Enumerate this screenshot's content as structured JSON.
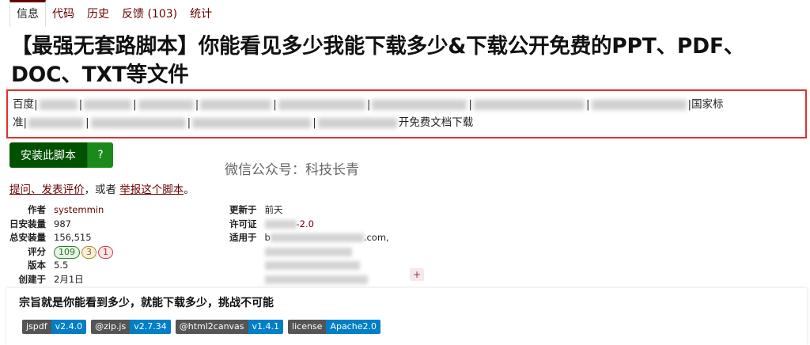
{
  "tabs": [
    {
      "label": "信息",
      "active": true
    },
    {
      "label": "代码",
      "active": false
    },
    {
      "label": "历史",
      "active": false
    },
    {
      "label": "反馈 (103)",
      "active": false
    },
    {
      "label": "统计",
      "active": false
    }
  ],
  "title": "【最强无套路脚本】你能看见多少我能下载多少&下载公开免费的PPT、PDF、DOC、TXT等文件",
  "description": {
    "line1_visible_start": "百度",
    "line1_visible_end": "国家标",
    "line2_start": "准",
    "line2_end": "开免费文档下载",
    "separator": "|"
  },
  "install": {
    "label": "安装此脚本",
    "help_label": "?"
  },
  "watermark": "微信公众号：科技长青",
  "feedback": {
    "link1": "提问、发表评价",
    "middle": "，或者",
    "link2": "举报这个脚本",
    "end": "。"
  },
  "meta_left": {
    "author_label": "作者",
    "author_value": "systemmin",
    "daily_label": "日安装量",
    "daily_value": "987",
    "total_label": "总安装量",
    "total_value": "156,515",
    "rating_label": "评分",
    "rating_good": "109",
    "rating_ok": "3",
    "rating_bad": "1",
    "version_label": "版本",
    "version_value": "5.5",
    "created_label": "创建于",
    "created_value": "2月1日"
  },
  "meta_right": {
    "updated_label": "更新于",
    "updated_value": "前天",
    "license_label": "许可证",
    "license_suffix": "-2.0",
    "applies_label": "适用于",
    "applies_suffix": ".com,",
    "applies_prefix": "b",
    "plus": "+"
  },
  "motto": "宗旨就是你能看到多少，就能下载多少，挑战不可能",
  "shields": [
    {
      "left": "jspdf",
      "right": "v2.4.0"
    },
    {
      "left": "@zip.js",
      "right": "v2.7.34"
    },
    {
      "left": "@html2canvas",
      "right": "v1.4.1"
    },
    {
      "left": "license",
      "right": "Apache2.0"
    }
  ],
  "colors": {
    "accent": "#670000",
    "install": "#005200",
    "highlight_border": "#e2302a",
    "shield_value": "#007ec6"
  }
}
